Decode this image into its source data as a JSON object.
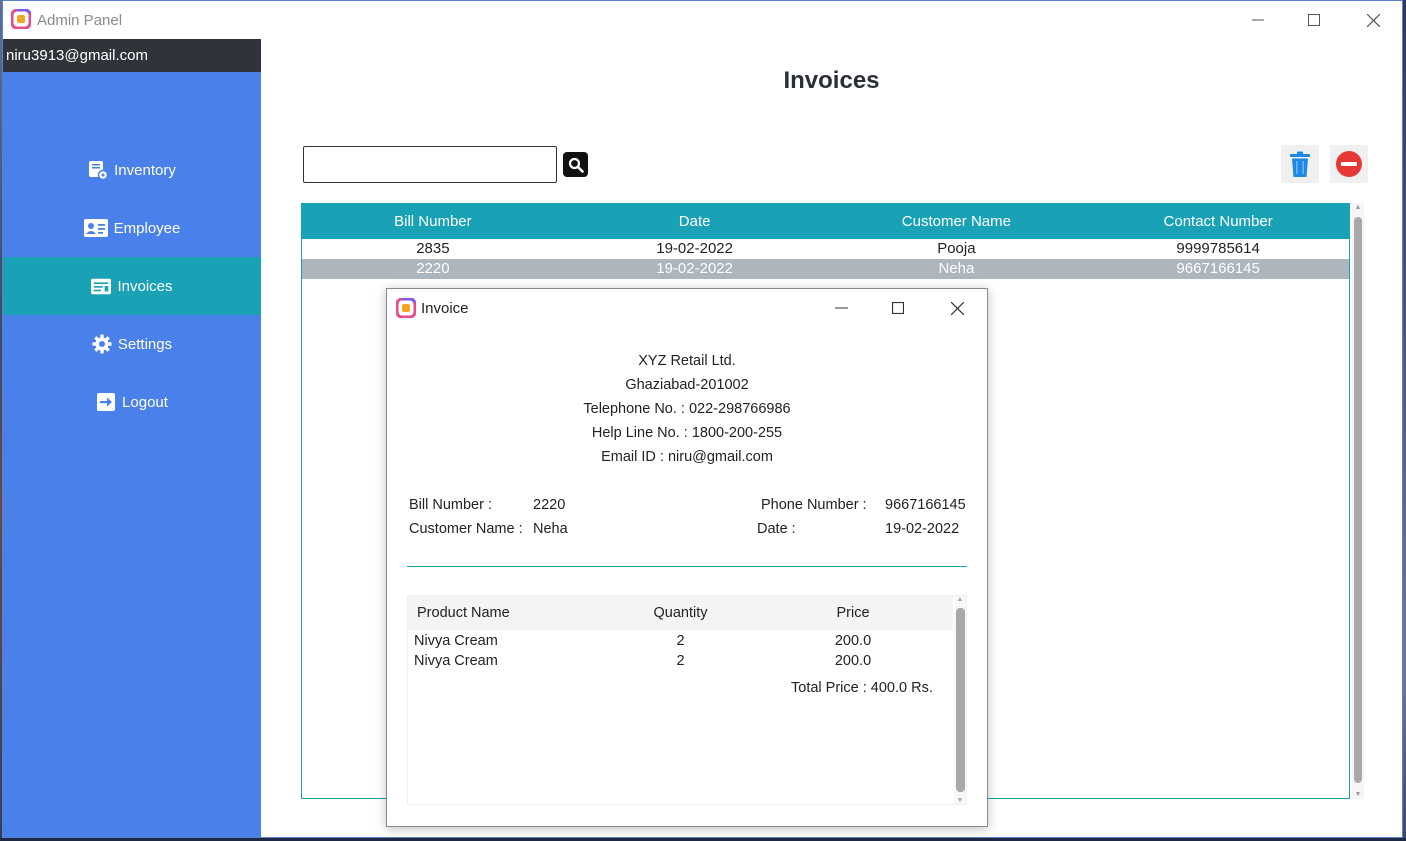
{
  "window": {
    "title": "Admin Panel",
    "controls": {
      "minimize": "—",
      "maximize": "☐",
      "close": "✕"
    }
  },
  "sidebar": {
    "user_email": "niru3913@gmail.com",
    "items": [
      {
        "label": "Inventory",
        "icon": "inventory-icon",
        "active": false
      },
      {
        "label": "Employee",
        "icon": "employee-card-icon",
        "active": false
      },
      {
        "label": "Invoices",
        "icon": "invoice-icon",
        "active": true
      },
      {
        "label": "Settings",
        "icon": "gear-icon",
        "active": false
      },
      {
        "label": "Logout",
        "icon": "logout-icon",
        "active": false
      }
    ]
  },
  "main": {
    "title": "Invoices",
    "search": {
      "value": "",
      "placeholder": ""
    },
    "table": {
      "headers": [
        "Bill Number",
        "Date",
        "Customer Name",
        "Contact Number"
      ],
      "rows": [
        [
          "2835",
          "19-02-2022",
          "Pooja",
          "9999785614"
        ],
        [
          "2220",
          "19-02-2022",
          "Neha",
          "9667166145"
        ]
      ],
      "selected_row": 1
    }
  },
  "invoice_dialog": {
    "title": "Invoice",
    "company": {
      "name": "XYZ Retail Ltd.",
      "address": "Ghaziabad-201002",
      "telephone": "Telephone No. : 022-298766986",
      "helpline": "Help Line No. : 1800-200-255",
      "email": "Email ID : niru@gmail.com"
    },
    "bill_number_label": "Bill Number :",
    "bill_number": "2220",
    "customer_name_label": "Customer Name :",
    "customer_name": "Neha",
    "phone_label": "Phone Number :",
    "phone": "9667166145",
    "date_label": "Date :",
    "date": "19-02-2022",
    "products": {
      "headers": [
        "Product Name",
        "Quantity",
        "Price"
      ],
      "rows": [
        [
          "Nivya Cream",
          "2",
          "200.0"
        ],
        [
          "Nivya Cream",
          "2",
          "200.0"
        ]
      ],
      "total": "Total Price : 400.0 Rs."
    }
  },
  "colors": {
    "sidebar": "#4a80ea",
    "accent": "#19a1b5",
    "user_bar": "#30343a",
    "selected_row": "#adb5bd",
    "delete": "#1e88e5",
    "cancel": "#e53935"
  }
}
